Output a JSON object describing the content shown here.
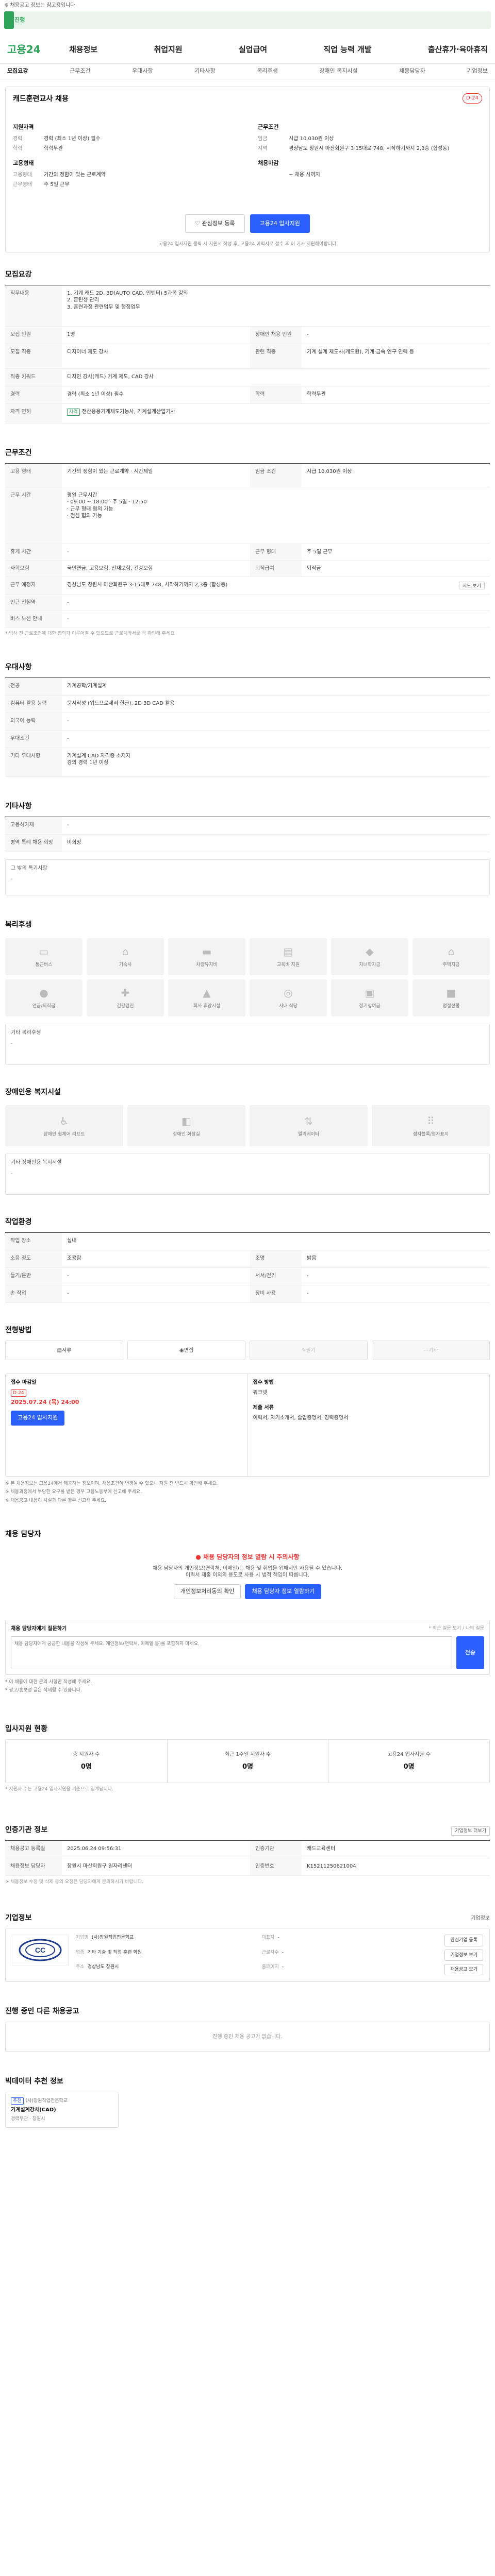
{
  "notice": "※ 채용공고 정보는 참고용입니다",
  "progress": {
    "label": "진행",
    "percent": 2
  },
  "brand": {
    "name": "고용24"
  },
  "gnb": [
    "채용정보",
    "취업지원",
    "실업급여",
    "직업 능력 개발",
    "출산휴가·육아휴직"
  ],
  "tabs": [
    "모집요강",
    "근무조건",
    "우대사항",
    "기타사항",
    "복리후생",
    "장애인 복지시설",
    "채용담당자",
    "기업정보"
  ],
  "job": {
    "title": "캐드훈련교사 채용",
    "dday": "D-24",
    "left": {
      "h": "지원자격",
      "items": [
        {
          "k": "경력",
          "v": "경력 (최소 1년 이상) 필수"
        },
        {
          "k": "학력",
          "v": "학력무관"
        }
      ],
      "h2": "고용형태",
      "items2": [
        {
          "k": "고용형태",
          "v": "기간의 정함이 있는 근로계약"
        },
        {
          "k": "근무형태",
          "v": "주 5일 근무"
        }
      ]
    },
    "right": {
      "h": "근무조건",
      "items": [
        {
          "k": "임금",
          "v": "시급 10,030원 이상"
        },
        {
          "k": "지역",
          "v": "경상남도 창원시 마산회원구 3·15대로 748, 시작하기까지 2,3층 (합성동)"
        }
      ],
      "h2": "채용마감",
      "items2": [
        {
          "k": "",
          "v": "~ 채용 시까지"
        }
      ]
    },
    "btn_scrap": "관심정보 등록",
    "btn_apply": "고용24 입사지원",
    "hint": "고용24 입사지원 클릭 시 지원서 작성 후, 고용24 이력서로 접수 후 이 기사 지원해야합니다"
  },
  "recruit": {
    "title": "모집요강",
    "duty_label": "직무내용",
    "duty_text": "1. 기계 캐드 2D, 3D(AUTO CAD, 인벤터) 5과목 강의\n2. 훈련생 관리\n3. 훈련과정 관련업무 및 행정업무",
    "rows": [
      [
        {
          "k": "모집 인원",
          "v": "1명"
        },
        {
          "k": "장애인 채용 인원",
          "v": "-"
        }
      ],
      [
        {
          "k": "모집 직종",
          "v": "디자이너 제도 강사"
        },
        {
          "k": "관련 직종",
          "v": "기계 설계 제도사(캐드원), 기계·금속 연구 인력 등"
        }
      ],
      [
        {
          "k": "직종 키워드",
          "v": "디자인 강사(캐드) 기계 제도, CAD 강사"
        }
      ],
      [
        {
          "k": "경력",
          "v": "경력 (최소 1년 이상) 필수"
        },
        {
          "k": "학력",
          "v": "학력무관"
        }
      ],
      [
        {
          "k": "자격 면허",
          "v": "전산응용기계제도기능사, 기계설계산업기사"
        }
      ]
    ]
  },
  "condition": {
    "title": "근무조건",
    "rows": [
      [
        {
          "k": "고용 형태",
          "v": "기간의 정함이 있는 근로계약 · 시간제일"
        },
        {
          "k": "임금 조건",
          "v": "시급 10,030원 이상"
        }
      ],
      [
        {
          "k": "근무 시간",
          "v": "평일 근무시간\n· 09:00 ~ 18:00 · 주 5일 · 12:50\n· 근무 형태 협의 가능\n· 점심 협의 가능"
        }
      ],
      [
        {
          "k": "휴게 시간",
          "v": "-"
        },
        {
          "k": "근무 형태",
          "v": "주 5일 근무"
        }
      ],
      [
        {
          "k": "사회보험",
          "v": "국민연금, 고용보험, 산재보험, 건강보험"
        },
        {
          "k": "퇴직급여",
          "v": "퇴직금"
        }
      ],
      [
        {
          "k": "근무 예정지",
          "v": "경상남도 창원시 마산회원구 3·15대로 748, 시작하기까지 2,3층 (합성동)"
        }
      ],
      [
        {
          "k": "인근 전철역",
          "v": "-"
        }
      ],
      [
        {
          "k": "버스 노선 안내",
          "v": "-"
        }
      ]
    ],
    "map_btn": "지도 보기",
    "note": "* 입사 전 근로조건에 대한 합의가 이루어질 수 있으므로 근로계약서를 꼭 확인해 주세요"
  },
  "prefer": {
    "title": "우대사항",
    "rows": [
      {
        "k": "전공",
        "v": "기계공학/기계설계"
      },
      {
        "k": "컴퓨터 활용 능력",
        "v": "문서작성 (워드프로세서·한글), 2D·3D CAD 활용"
      },
      {
        "k": "외국어 능력",
        "v": "-"
      },
      {
        "k": "우대조건",
        "v": "-"
      },
      {
        "k": "기타 우대사항",
        "v": "기계설계 CAD 자격증 소지자\n강의 경력 1년 이상"
      }
    ]
  },
  "etc": {
    "title": "기타사항",
    "rows": [
      {
        "k": "고용허가제",
        "v": "-"
      },
      {
        "k": "병역 특례 채용 희망",
        "v": "비희망"
      }
    ],
    "box_label": "그 밖의 특기사항",
    "box_text": "-"
  },
  "welfare": {
    "title": "복리후생",
    "items": [
      "통근버스",
      "기숙사",
      "차량유지비",
      "교육비 지원",
      "자녀학자금",
      "주택자금",
      "연금/퇴직금",
      "건강검진",
      "회사 휴양시설",
      "사내 식당",
      "정기상여금",
      "명절선물"
    ],
    "box_label": "기타 복리후생",
    "box_text": "-"
  },
  "disabled": {
    "title": "장애인용 복지시설",
    "items": [
      "장애인 휠체어 리프트",
      "장애인 화장실",
      "엘리베이터",
      "점자블록/점자표지"
    ],
    "box_label": "기타 장애인용 복지시설",
    "box_text": "-"
  },
  "workenv": {
    "title": "작업환경",
    "rows": [
      [
        {
          "k": "작업 장소",
          "v": "실내"
        }
      ],
      [
        {
          "k": "소음 정도",
          "v": "조용함"
        },
        {
          "k": "조명",
          "v": "밝음"
        }
      ],
      [
        {
          "k": "들기/운반",
          "v": "-"
        },
        {
          "k": "서서/걷기",
          "v": "-"
        }
      ],
      [
        {
          "k": "손 작업",
          "v": "-"
        },
        {
          "k": "장비 사용",
          "v": "-"
        }
      ]
    ]
  },
  "process": {
    "title": "전형방법",
    "items": [
      "서류",
      "면접",
      "필기",
      "기타"
    ]
  },
  "application": {
    "deadline_label": "접수 마감일",
    "deadline": "2025.07.24 (목) 24:00",
    "deadline_tag": "D-24",
    "btn": "고용24 입사지원",
    "method_label": "접수 방법",
    "method": "워크넷",
    "docs_label": "제출 서류",
    "docs": "이력서, 자기소개서, 졸업증명서, 경력증명서",
    "bullets": [
      "※ 본 채용정보는 고용24에서 제공하는 정보이며, 채용조건이 변경될 수 있으니 지원 전 반드시 확인해 주세요.",
      "※ 채용과정에서 부당한 요구를 받은 경우 고용노동부에 신고해 주세요.",
      "※ 채용공고 내용이 사실과 다른 경우 신고해 주세요."
    ]
  },
  "manager": {
    "title": "채용 담당자",
    "warn": "채용 담당자의 정보 열람 시 주의사항",
    "desc": "채용 담당자의 개인정보(연락처, 이메일)는 채용 및 취업을 위해서만 사용될 수 있습니다.",
    "desc2": "이력서 제출 이외의 용도로 사용 시 법적 책임이 따릅니다.",
    "btn1": "개인정보처리동의 확인",
    "btn2": "채용 담당자 정보 열람하기"
  },
  "qna": {
    "title": "채용 담당자에게 질문하기",
    "side": "* 최근 질문 보기 / 나의 질문",
    "placeholder": "채용 담당자에게 궁금한 내용을 작성해 주세요. 개인정보(연락처, 이메일 등)를 포함하지 마세요.",
    "send": "전송",
    "bullets": [
      "* 이 채용에 대한 문의 사항만 작성해 주세요.",
      "* 광고/홍보성 글은 삭제될 수 있습니다."
    ]
  },
  "stats": {
    "title": "입사지원 현황",
    "items": [
      {
        "label": "총 지원자 수",
        "num": "0명"
      },
      {
        "label": "최근 1주일 지원자 수",
        "num": "0명"
      },
      {
        "label": "고용24 입사지원 수",
        "num": "0명"
      }
    ],
    "note": "* 지원자 수는 고용24 입사지원을 기준으로 집계됩니다."
  },
  "info": {
    "title": "인증기관 정보",
    "btn": "기업정보 더보기",
    "rows": [
      [
        {
          "k": "채용공고 등록일",
          "v": "2025.06.24 09:56:31"
        },
        {
          "k": "인증기관",
          "v": "캐드교육센터"
        }
      ],
      [
        {
          "k": "채용정보 담당자",
          "v": "창원시 마산회원구 일자리센터"
        },
        {
          "k": "인증번호",
          "v": "K15211250621004"
        }
      ]
    ],
    "note": "※ 채용정보 수정 및 삭제 등의 요청은 담당자에게 문의하시기 바랍니다."
  },
  "company": {
    "title": "기업정보",
    "btn": "기업정보",
    "logo": "CC",
    "info": [
      {
        "k": "기업명",
        "v": "(사)창원직업전문학교"
      },
      {
        "k": "대표자",
        "v": "-"
      },
      {
        "k": "업종",
        "v": "기타 기술 및 직업 훈련 학원"
      },
      {
        "k": "근로자수",
        "v": "-"
      },
      {
        "k": "주소",
        "v": "경상남도 창원시"
      },
      {
        "k": "홈페이지",
        "v": "-"
      }
    ],
    "b1": "관심기업 등록",
    "b2": "기업정보 보기",
    "b3": "채용공고 보기"
  },
  "others": {
    "title": "진행 중인 다른 채용공고",
    "empty": "진행 중인 채용 공고가 없습니다."
  },
  "recommend": {
    "title": "빅데이터 추천 정보",
    "badge": "추천",
    "company": "(사)창원직업전문학교",
    "job": "기계설계강사(CAD)",
    "meta": "경력무관 · 창원시"
  }
}
